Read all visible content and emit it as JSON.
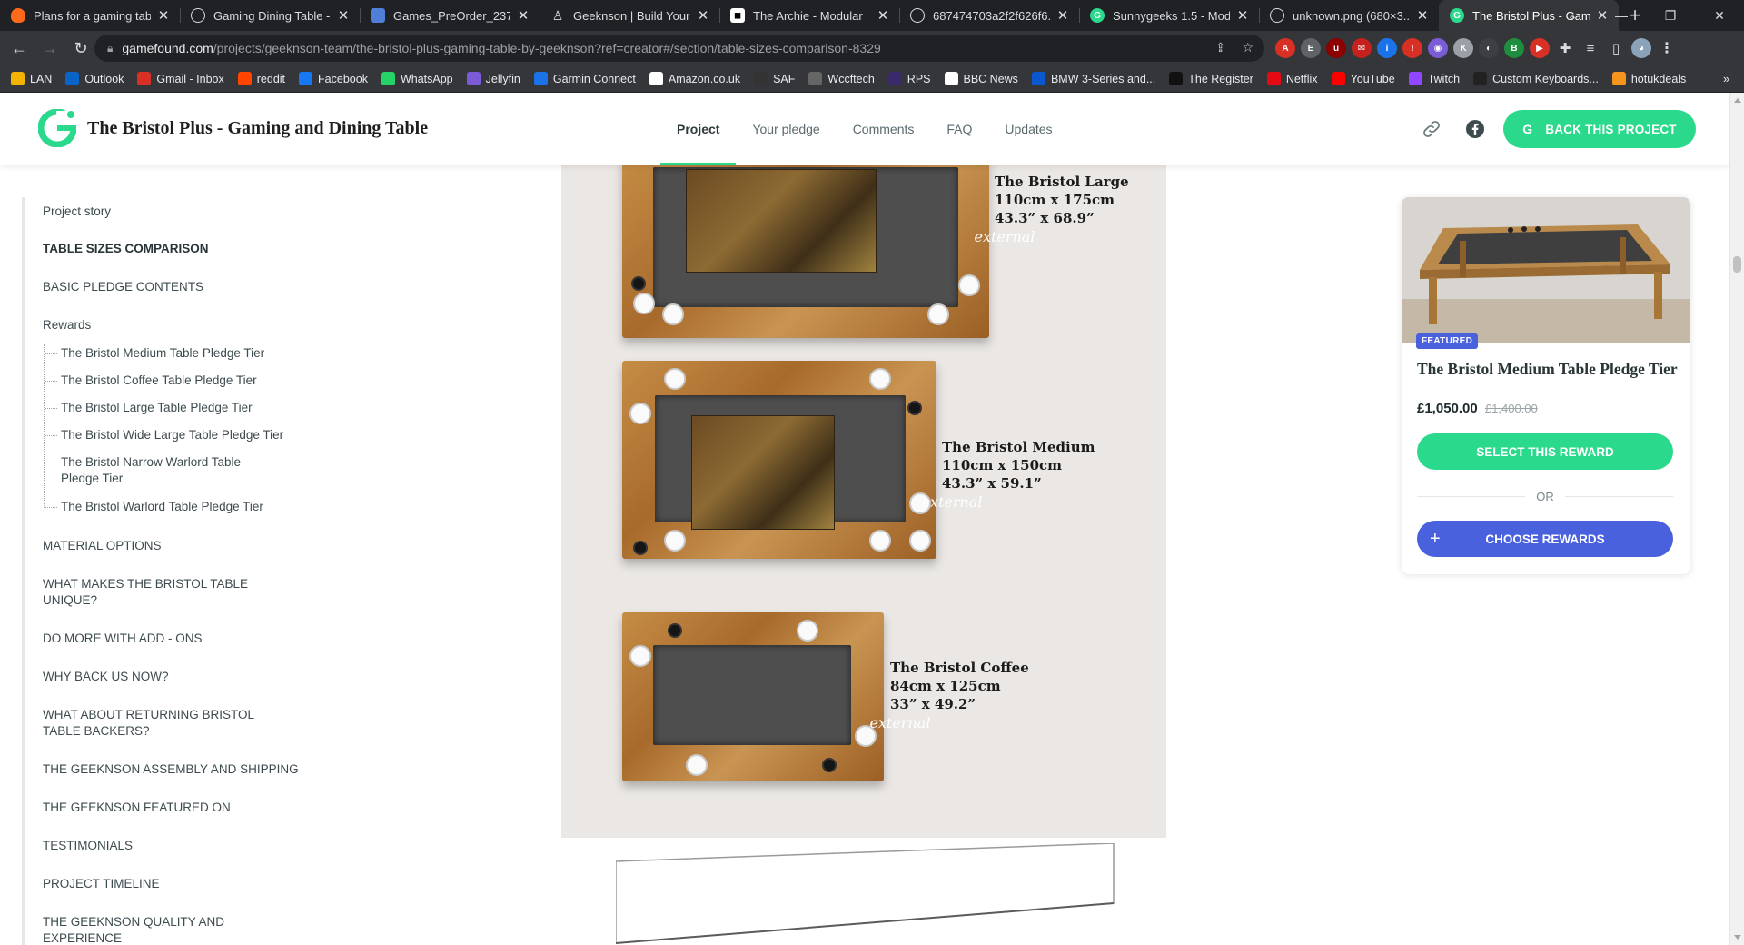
{
  "browser": {
    "tabs": [
      {
        "title": "Plans for a gaming table",
        "color": "#ff6a1a",
        "glyph": ""
      },
      {
        "title": "Gaming Dining Table - ",
        "color": "#5f6368",
        "glyph": "◎"
      },
      {
        "title": "Games_PreOrder_237...",
        "color": "#4f7fd6",
        "glyph": "▤"
      },
      {
        "title": "Geeknson | Build Your",
        "color": "#202124",
        "glyph": "♙"
      },
      {
        "title": "The Archie - Modular ",
        "color": "#ffffff",
        "glyph": "◼"
      },
      {
        "title": "687474703a2f2f626f6...",
        "color": "#5f6368",
        "glyph": "◎"
      },
      {
        "title": "Sunnygeeks 1.5 - Mod",
        "color": "#2bd98c",
        "glyph": "G"
      },
      {
        "title": "unknown.png (680×3...",
        "color": "#5f6368",
        "glyph": "◎"
      },
      {
        "title": "The Bristol Plus - Gam",
        "color": "#2bd98c",
        "glyph": "G",
        "active": true
      }
    ],
    "url_domain": "gamefound.com",
    "url_path": "/projects/geeknson-team/the-bristol-plus-gaming-table-by-geeknson?ref=creator#/section/table-sizes-comparison-8329",
    "bookmarks": [
      {
        "label": "LAN",
        "color": "#f2b400"
      },
      {
        "label": "Outlook",
        "color": "#0a64c7"
      },
      {
        "label": "Gmail - Inbox",
        "color": "#d93025"
      },
      {
        "label": "reddit",
        "color": "#ff4500"
      },
      {
        "label": "Facebook",
        "color": "#1877f2"
      },
      {
        "label": "WhatsApp",
        "color": "#25d366"
      },
      {
        "label": "Jellyfin",
        "color": "#7b5bd6"
      },
      {
        "label": "Garmin Connect",
        "color": "#1a73e8"
      },
      {
        "label": "Amazon.co.uk",
        "color": "#ffffff"
      },
      {
        "label": "SAF",
        "color": "#333333"
      },
      {
        "label": "Wccftech",
        "color": "#666666"
      },
      {
        "label": "RPS",
        "color": "#3b2a6b"
      },
      {
        "label": "BBC News",
        "color": "#ffffff"
      },
      {
        "label": "BMW 3-Series and...",
        "color": "#0b57d0"
      },
      {
        "label": "The Register",
        "color": "#111111"
      },
      {
        "label": "Netflix",
        "color": "#e50914"
      },
      {
        "label": "YouTube",
        "color": "#ff0000"
      },
      {
        "label": "Twitch",
        "color": "#9146ff"
      },
      {
        "label": "Custom Keyboards...",
        "color": "#222222"
      },
      {
        "label": "hotukdeals",
        "color": "#f7941d"
      }
    ],
    "more_bookmarks": "»"
  },
  "header": {
    "title": "The Bristol Plus - Gaming and Dining Table",
    "nav": [
      "Project",
      "Your pledge",
      "Comments",
      "FAQ",
      "Updates"
    ],
    "active_nav": "Project",
    "back_button": "BACK THIS PROJECT",
    "accent": "#2bd98c"
  },
  "sidebar": {
    "items": [
      "Project story",
      "TABLE SIZES COMPARISON",
      "BASIC PLEDGE CONTENTS",
      "Rewards",
      "MATERIAL OPTIONS",
      "WHAT MAKES THE BRISTOL TABLE",
      "UNIQUE?",
      "DO MORE WITH ADD - ONS",
      "WHY BACK US NOW?",
      "WHAT ABOUT RETURNING BRISTOL",
      "TABLE BACKERS?",
      "THE GEEKNSON ASSEMBLY AND SHIPPING",
      "THE GEEKNSON FEATURED ON",
      "TESTIMONIALS",
      "PROJECT TIMELINE",
      "THE GEEKNSON QUALITY AND",
      "EXPERIENCE"
    ],
    "rewards": [
      "The Bristol Medium Table Pledge Tier",
      "The Bristol Coffee Table Pledge Tier",
      "The Bristol Large Table Pledge Tier",
      "The Bristol Wide Large Table Pledge Tier",
      "The Bristol Narrow Warlord Table",
      "Pledge Tier",
      "The Bristol Warlord Table Pledge Tier"
    ]
  },
  "hero": {
    "tables": [
      {
        "name": "The Bristol Large",
        "metric": "110cm x 175cm",
        "imperial": "43.3” x 68.9”",
        "note": "external"
      },
      {
        "name": "The Bristol Medium",
        "metric": "110cm x 150cm",
        "imperial": "43.3” x 59.1”",
        "note": "external"
      },
      {
        "name": "The Bristol Coffee",
        "metric": "84cm x 125cm",
        "imperial": "33” x 49.2”",
        "note": "external"
      }
    ]
  },
  "reward_card": {
    "badge": "FEATURED",
    "title": "The Bristol Medium Table Pledge Tier",
    "price": "£1,050.00",
    "old_price": "£1,400.00",
    "select_button": "SELECT THIS REWARD",
    "or_text": "OR",
    "choose_button": "CHOOSE REWARDS",
    "select_color": "#2bd98c",
    "choose_color": "#4a61dd"
  }
}
